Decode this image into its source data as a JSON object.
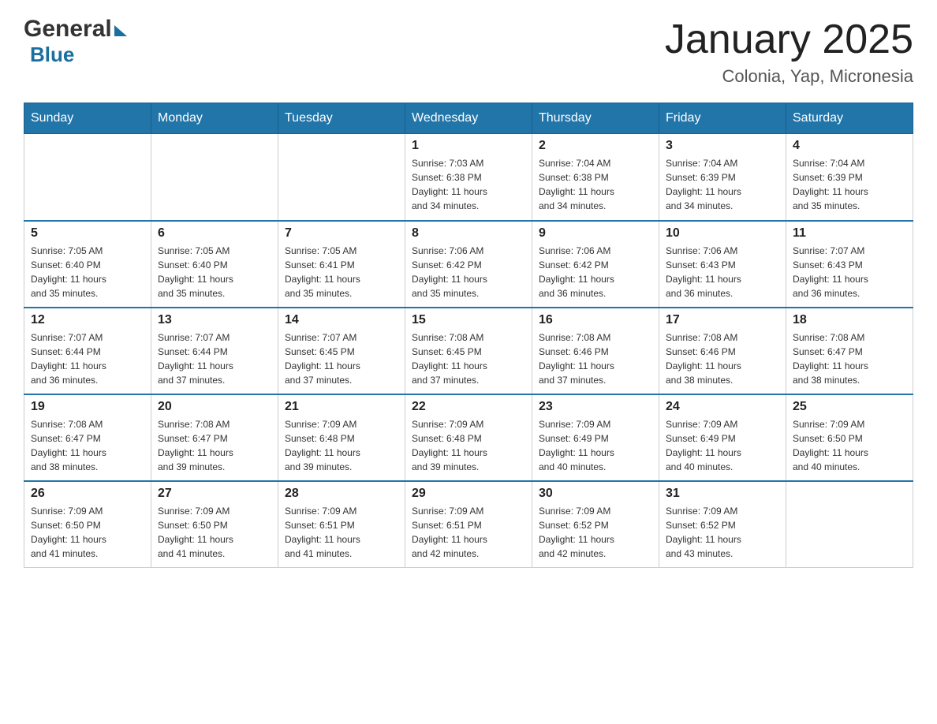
{
  "header": {
    "month_title": "January 2025",
    "location": "Colonia, Yap, Micronesia",
    "logo_general": "General",
    "logo_blue": "Blue"
  },
  "days_of_week": [
    "Sunday",
    "Monday",
    "Tuesday",
    "Wednesday",
    "Thursday",
    "Friday",
    "Saturday"
  ],
  "weeks": [
    [
      {
        "day": "",
        "info": ""
      },
      {
        "day": "",
        "info": ""
      },
      {
        "day": "",
        "info": ""
      },
      {
        "day": "1",
        "info": "Sunrise: 7:03 AM\nSunset: 6:38 PM\nDaylight: 11 hours\nand 34 minutes."
      },
      {
        "day": "2",
        "info": "Sunrise: 7:04 AM\nSunset: 6:38 PM\nDaylight: 11 hours\nand 34 minutes."
      },
      {
        "day": "3",
        "info": "Sunrise: 7:04 AM\nSunset: 6:39 PM\nDaylight: 11 hours\nand 34 minutes."
      },
      {
        "day": "4",
        "info": "Sunrise: 7:04 AM\nSunset: 6:39 PM\nDaylight: 11 hours\nand 35 minutes."
      }
    ],
    [
      {
        "day": "5",
        "info": "Sunrise: 7:05 AM\nSunset: 6:40 PM\nDaylight: 11 hours\nand 35 minutes."
      },
      {
        "day": "6",
        "info": "Sunrise: 7:05 AM\nSunset: 6:40 PM\nDaylight: 11 hours\nand 35 minutes."
      },
      {
        "day": "7",
        "info": "Sunrise: 7:05 AM\nSunset: 6:41 PM\nDaylight: 11 hours\nand 35 minutes."
      },
      {
        "day": "8",
        "info": "Sunrise: 7:06 AM\nSunset: 6:42 PM\nDaylight: 11 hours\nand 35 minutes."
      },
      {
        "day": "9",
        "info": "Sunrise: 7:06 AM\nSunset: 6:42 PM\nDaylight: 11 hours\nand 36 minutes."
      },
      {
        "day": "10",
        "info": "Sunrise: 7:06 AM\nSunset: 6:43 PM\nDaylight: 11 hours\nand 36 minutes."
      },
      {
        "day": "11",
        "info": "Sunrise: 7:07 AM\nSunset: 6:43 PM\nDaylight: 11 hours\nand 36 minutes."
      }
    ],
    [
      {
        "day": "12",
        "info": "Sunrise: 7:07 AM\nSunset: 6:44 PM\nDaylight: 11 hours\nand 36 minutes."
      },
      {
        "day": "13",
        "info": "Sunrise: 7:07 AM\nSunset: 6:44 PM\nDaylight: 11 hours\nand 37 minutes."
      },
      {
        "day": "14",
        "info": "Sunrise: 7:07 AM\nSunset: 6:45 PM\nDaylight: 11 hours\nand 37 minutes."
      },
      {
        "day": "15",
        "info": "Sunrise: 7:08 AM\nSunset: 6:45 PM\nDaylight: 11 hours\nand 37 minutes."
      },
      {
        "day": "16",
        "info": "Sunrise: 7:08 AM\nSunset: 6:46 PM\nDaylight: 11 hours\nand 37 minutes."
      },
      {
        "day": "17",
        "info": "Sunrise: 7:08 AM\nSunset: 6:46 PM\nDaylight: 11 hours\nand 38 minutes."
      },
      {
        "day": "18",
        "info": "Sunrise: 7:08 AM\nSunset: 6:47 PM\nDaylight: 11 hours\nand 38 minutes."
      }
    ],
    [
      {
        "day": "19",
        "info": "Sunrise: 7:08 AM\nSunset: 6:47 PM\nDaylight: 11 hours\nand 38 minutes."
      },
      {
        "day": "20",
        "info": "Sunrise: 7:08 AM\nSunset: 6:47 PM\nDaylight: 11 hours\nand 39 minutes."
      },
      {
        "day": "21",
        "info": "Sunrise: 7:09 AM\nSunset: 6:48 PM\nDaylight: 11 hours\nand 39 minutes."
      },
      {
        "day": "22",
        "info": "Sunrise: 7:09 AM\nSunset: 6:48 PM\nDaylight: 11 hours\nand 39 minutes."
      },
      {
        "day": "23",
        "info": "Sunrise: 7:09 AM\nSunset: 6:49 PM\nDaylight: 11 hours\nand 40 minutes."
      },
      {
        "day": "24",
        "info": "Sunrise: 7:09 AM\nSunset: 6:49 PM\nDaylight: 11 hours\nand 40 minutes."
      },
      {
        "day": "25",
        "info": "Sunrise: 7:09 AM\nSunset: 6:50 PM\nDaylight: 11 hours\nand 40 minutes."
      }
    ],
    [
      {
        "day": "26",
        "info": "Sunrise: 7:09 AM\nSunset: 6:50 PM\nDaylight: 11 hours\nand 41 minutes."
      },
      {
        "day": "27",
        "info": "Sunrise: 7:09 AM\nSunset: 6:50 PM\nDaylight: 11 hours\nand 41 minutes."
      },
      {
        "day": "28",
        "info": "Sunrise: 7:09 AM\nSunset: 6:51 PM\nDaylight: 11 hours\nand 41 minutes."
      },
      {
        "day": "29",
        "info": "Sunrise: 7:09 AM\nSunset: 6:51 PM\nDaylight: 11 hours\nand 42 minutes."
      },
      {
        "day": "30",
        "info": "Sunrise: 7:09 AM\nSunset: 6:52 PM\nDaylight: 11 hours\nand 42 minutes."
      },
      {
        "day": "31",
        "info": "Sunrise: 7:09 AM\nSunset: 6:52 PM\nDaylight: 11 hours\nand 43 minutes."
      },
      {
        "day": "",
        "info": ""
      }
    ]
  ]
}
